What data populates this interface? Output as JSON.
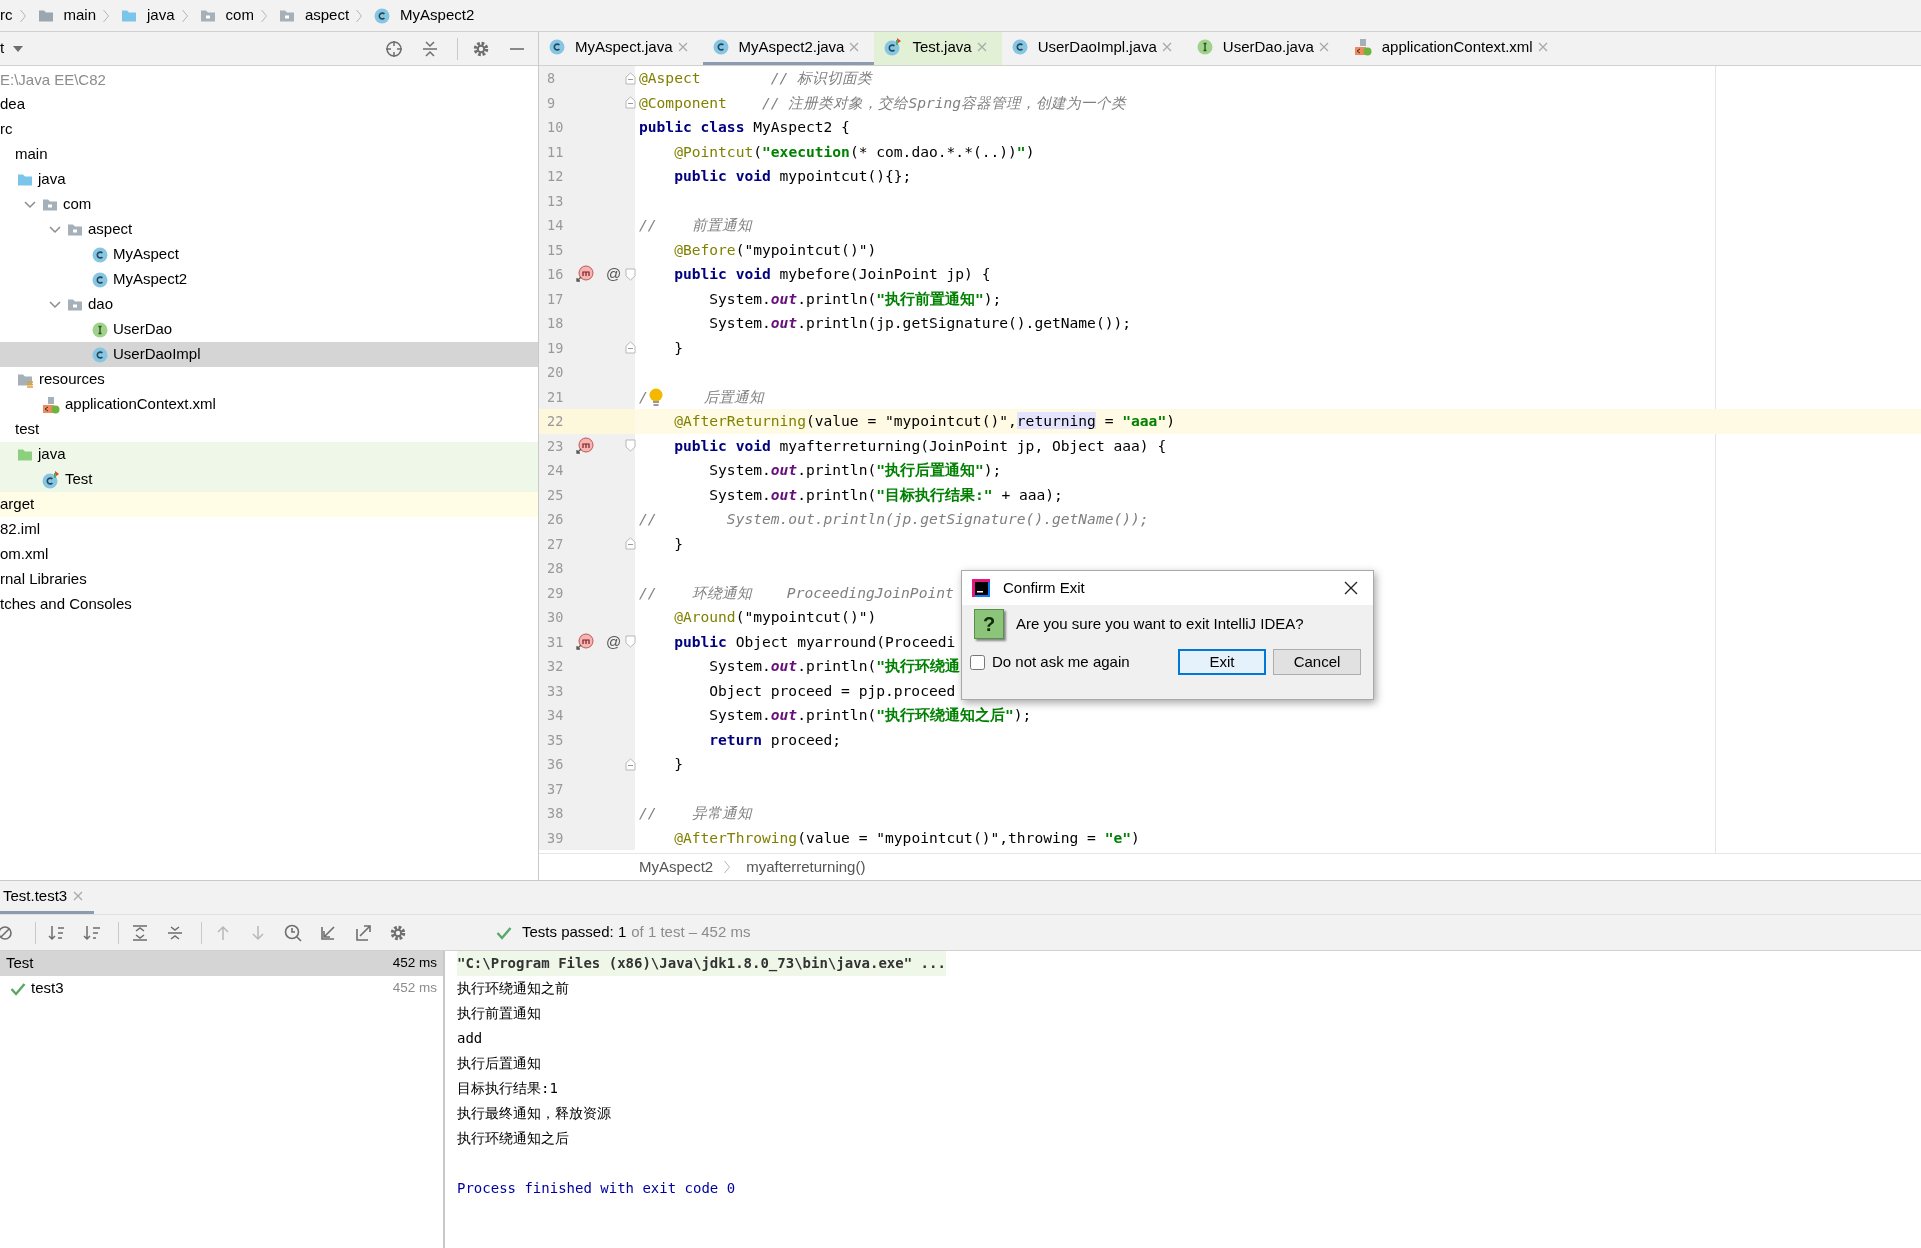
{
  "breadcrumb": [
    {
      "label": "rc"
    },
    {
      "label": "main",
      "kind": "folder"
    },
    {
      "label": "java",
      "kind": "source-folder"
    },
    {
      "label": "com",
      "kind": "package"
    },
    {
      "label": "aspect",
      "kind": "package"
    },
    {
      "label": "MyAspect2",
      "kind": "class"
    }
  ],
  "project": {
    "title": "t",
    "root_path": "E:\\Java EE\\C82",
    "items": [
      {
        "label": "dea",
        "selected": false
      },
      {
        "label": "rc",
        "selected": false,
        "children": [
          {
            "label": "main",
            "selected": false,
            "children": [
              {
                "label": "java",
                "kind": "source-folder",
                "selected": false,
                "children": [
                  {
                    "label": "com",
                    "kind": "package",
                    "selected": false,
                    "children": [
                      {
                        "label": "aspect",
                        "kind": "package",
                        "selected": false,
                        "children": [
                          {
                            "label": "MyAspect",
                            "kind": "class",
                            "selected": false
                          },
                          {
                            "label": "MyAspect2",
                            "kind": "class",
                            "selected": false
                          }
                        ]
                      },
                      {
                        "label": "dao",
                        "kind": "package",
                        "selected": false,
                        "children": [
                          {
                            "label": "UserDao",
                            "kind": "interface",
                            "selected": false
                          },
                          {
                            "label": "UserDaoImpl",
                            "kind": "class",
                            "selected": true
                          }
                        ]
                      }
                    ]
                  }
                ]
              },
              {
                "label": "resources",
                "kind": "resources",
                "selected": false,
                "children": [
                  {
                    "label": "applicationContext.xml",
                    "kind": "xml",
                    "selected": false
                  }
                ]
              }
            ]
          },
          {
            "label": "test",
            "selected": false,
            "children": [
              {
                "label": "java",
                "kind": "test-folder",
                "test_source": true,
                "selected": false,
                "children": [
                  {
                    "label": "Test",
                    "kind": "test-class",
                    "test_source": true,
                    "selected": false
                  }
                ]
              }
            ]
          }
        ]
      },
      {
        "label": "arget",
        "excluded": true,
        "selected": false
      },
      {
        "label": "82.iml",
        "selected": false
      },
      {
        "label": "om.xml",
        "selected": false
      },
      {
        "label": "rnal Libraries",
        "selected": false
      },
      {
        "label": "tches and Consoles",
        "selected": false
      }
    ]
  },
  "editor": {
    "tabs": [
      {
        "label": "MyAspect.java",
        "kind": "class",
        "selected": false
      },
      {
        "label": "MyAspect2.java",
        "kind": "class",
        "selected": true
      },
      {
        "label": "Test.java",
        "kind": "test-class",
        "test_source": true,
        "selected": false
      },
      {
        "label": "UserDaoImpl.java",
        "kind": "class",
        "selected": false
      },
      {
        "label": "UserDao.java",
        "kind": "interface",
        "selected": false
      },
      {
        "label": "applicationContext.xml",
        "kind": "xml",
        "selected": false
      }
    ],
    "lines": [
      {
        "number": "8",
        "current": false,
        "gutter": [
          {
            "kind": "fold-end"
          }
        ],
        "tokens": [
          {
            "kind": "annotation",
            "text": "@Aspect"
          },
          {
            "kind": "comment",
            "text": "        // 标识切面类"
          }
        ]
      },
      {
        "number": "9",
        "current": false,
        "gutter": [
          {
            "kind": "fold-end"
          }
        ],
        "tokens": [
          {
            "kind": "annotation",
            "text": "@Component"
          },
          {
            "kind": "comment",
            "text": "    // 注册类对象，交给Spring容器管理，创建为一个类"
          }
        ]
      },
      {
        "number": "10",
        "current": false,
        "tokens": [
          {
            "kind": "keyword",
            "text": "public class"
          },
          {
            "kind": "plain",
            "text": " MyAspect2 {"
          }
        ]
      },
      {
        "number": "11",
        "current": false,
        "tokens": [
          {
            "kind": "annotation",
            "text": "    @Pointcut"
          },
          {
            "kind": "plain",
            "text": "("
          },
          {
            "kind": "string",
            "text": "\"execution"
          },
          {
            "kind": "plain",
            "text": "(* com.dao.*.*(..))"
          },
          {
            "kind": "string",
            "text": "\""
          },
          {
            "kind": "plain",
            "text": ")"
          }
        ]
      },
      {
        "number": "12",
        "current": false,
        "tokens": [
          {
            "kind": "keyword",
            "text": "    public void"
          },
          {
            "kind": "plain",
            "text": " mypointcut(){};"
          }
        ]
      },
      {
        "number": "13",
        "current": false
      },
      {
        "number": "14",
        "current": false,
        "tokens": [
          {
            "kind": "comment",
            "text": "//    前置通知"
          }
        ]
      },
      {
        "number": "15",
        "current": false,
        "tokens": [
          {
            "kind": "annotation",
            "text": "    @Before"
          },
          {
            "kind": "plain",
            "text": "(\"mypointcut()\")"
          }
        ]
      },
      {
        "number": "16",
        "current": false,
        "gutter": [
          {
            "kind": "method"
          },
          {
            "kind": "annotation",
            "glyph": "@"
          },
          {
            "kind": "fold-start"
          }
        ],
        "tokens": [
          {
            "kind": "keyword",
            "text": "    public void"
          },
          {
            "kind": "plain",
            "text": " mybefore(JoinPoint jp) {"
          }
        ]
      },
      {
        "number": "17",
        "current": false,
        "tokens": [
          {
            "kind": "plain",
            "text": "        System."
          },
          {
            "kind": "field",
            "text": "out"
          },
          {
            "kind": "plain",
            "text": ".println("
          },
          {
            "kind": "string",
            "text": "\"执行前置通知\""
          },
          {
            "kind": "plain",
            "text": ");"
          }
        ]
      },
      {
        "number": "18",
        "current": false,
        "tokens": [
          {
            "kind": "plain",
            "text": "        System."
          },
          {
            "kind": "field",
            "text": "out"
          },
          {
            "kind": "plain",
            "text": ".println(jp.getSignature().getName());"
          }
        ]
      },
      {
        "number": "19",
        "current": false,
        "gutter": [
          {
            "kind": "fold-end"
          }
        ],
        "tokens": [
          {
            "kind": "plain",
            "text": "    }"
          }
        ]
      },
      {
        "number": "20",
        "current": false
      },
      {
        "number": "21",
        "current": false,
        "tokens": [
          {
            "kind": "comment",
            "text": "/"
          },
          {
            "kind": "bulb"
          },
          {
            "kind": "comment",
            "text": "    后置通知"
          }
        ]
      },
      {
        "number": "22",
        "current": true,
        "tokens": [
          {
            "kind": "annotation",
            "text": "    @AfterReturning"
          },
          {
            "kind": "plain",
            "text": "(value = \"mypointcut()\","
          },
          {
            "kind": "highlight",
            "text": "returning"
          },
          {
            "kind": "plain",
            "text": " = "
          },
          {
            "kind": "string",
            "text": "\"aaa\""
          },
          {
            "kind": "plain",
            "text": ")"
          }
        ]
      },
      {
        "number": "23",
        "current": false,
        "gutter": [
          {
            "kind": "method"
          },
          {
            "kind": "fold-start"
          }
        ],
        "tokens": [
          {
            "kind": "keyword",
            "text": "    public void"
          },
          {
            "kind": "plain",
            "text": " myafterreturning(JoinPoint jp, Object aaa) {"
          }
        ]
      },
      {
        "number": "24",
        "current": false,
        "tokens": [
          {
            "kind": "plain",
            "text": "        System."
          },
          {
            "kind": "field",
            "text": "out"
          },
          {
            "kind": "plain",
            "text": ".println("
          },
          {
            "kind": "string",
            "text": "\"执行后置通知\""
          },
          {
            "kind": "plain",
            "text": ");"
          }
        ]
      },
      {
        "number": "25",
        "current": false,
        "tokens": [
          {
            "kind": "plain",
            "text": "        System."
          },
          {
            "kind": "field",
            "text": "out"
          },
          {
            "kind": "plain",
            "text": ".println("
          },
          {
            "kind": "string",
            "text": "\"目标执行结果:\""
          },
          {
            "kind": "plain",
            "text": " + aaa);"
          }
        ]
      },
      {
        "number": "26",
        "current": false,
        "tokens": [
          {
            "kind": "comment",
            "text": "//        System.out.println(jp.getSignature().getName());"
          }
        ]
      },
      {
        "number": "27",
        "current": false,
        "gutter": [
          {
            "kind": "fold-end"
          }
        ],
        "tokens": [
          {
            "kind": "plain",
            "text": "    }"
          }
        ]
      },
      {
        "number": "28",
        "current": false
      },
      {
        "number": "29",
        "current": false,
        "tokens": [
          {
            "kind": "comment",
            "text": "//    环绕通知    ProceedingJoinPoint"
          }
        ]
      },
      {
        "number": "30",
        "current": false,
        "tokens": [
          {
            "kind": "annotation",
            "text": "    @Around"
          },
          {
            "kind": "plain",
            "text": "(\"mypointcut()\")"
          }
        ]
      },
      {
        "number": "31",
        "current": false,
        "gutter": [
          {
            "kind": "method"
          },
          {
            "kind": "annotation",
            "glyph": "@"
          },
          {
            "kind": "fold-start"
          }
        ],
        "tokens": [
          {
            "kind": "keyword",
            "text": "    public"
          },
          {
            "kind": "plain",
            "text": " Object myarround(Proceedi"
          }
        ]
      },
      {
        "number": "32",
        "current": false,
        "tokens": [
          {
            "kind": "plain",
            "text": "        System."
          },
          {
            "kind": "field",
            "text": "out"
          },
          {
            "kind": "plain",
            "text": ".println("
          },
          {
            "kind": "string",
            "text": "\"执行环绕通"
          }
        ]
      },
      {
        "number": "33",
        "current": false,
        "tokens": [
          {
            "kind": "plain",
            "text": "        Object proceed = pjp.proceed"
          }
        ]
      },
      {
        "number": "34",
        "current": false,
        "tokens": [
          {
            "kind": "plain",
            "text": "        System."
          },
          {
            "kind": "field",
            "text": "out"
          },
          {
            "kind": "plain",
            "text": ".println("
          },
          {
            "kind": "string",
            "text": "\"执行环绕通知之后\""
          },
          {
            "kind": "plain",
            "text": ");"
          }
        ]
      },
      {
        "number": "35",
        "current": false,
        "tokens": [
          {
            "kind": "keyword",
            "text": "        return"
          },
          {
            "kind": "plain",
            "text": " proceed;"
          }
        ]
      },
      {
        "number": "36",
        "current": false,
        "gutter": [
          {
            "kind": "fold-end"
          }
        ],
        "tokens": [
          {
            "kind": "plain",
            "text": "    }"
          }
        ]
      },
      {
        "number": "37",
        "current": false
      },
      {
        "number": "38",
        "current": false,
        "tokens": [
          {
            "kind": "comment",
            "text": "//    异常通知"
          }
        ]
      },
      {
        "number": "39",
        "current": false,
        "tokens": [
          {
            "kind": "annotation",
            "text": "    @AfterThrowing"
          },
          {
            "kind": "plain",
            "text": "(value = \"mypointcut()\",throwing = "
          },
          {
            "kind": "string",
            "text": "\"e\""
          },
          {
            "kind": "plain",
            "text": ")"
          }
        ]
      }
    ],
    "path": [
      "MyAspect2",
      "myafterreturning()"
    ]
  },
  "dialog": {
    "title": "Confirm Exit",
    "glyph": "?",
    "message": "Are you sure you want to exit IntelliJ IDEA?",
    "dont_ask": {
      "label": "Do not ask me again",
      "checked": false
    },
    "buttons": [
      {
        "label": "Exit",
        "default": true
      },
      {
        "label": "Cancel",
        "default": false
      }
    ]
  },
  "run": {
    "tab": {
      "label": "Test.test3",
      "selected": true
    },
    "status": {
      "passed": "Tests passed: 1",
      "detail": "of 1 test – 452 ms"
    },
    "tests": [
      {
        "label": "Test",
        "time": "452 ms",
        "selected": true
      },
      {
        "label": "test3",
        "time": "452 ms",
        "selected": false,
        "passed": true
      }
    ],
    "console": [
      {
        "kind": "command",
        "text": "\"C:\\Program Files (x86)\\Java\\jdk1.8.0_73\\bin\\java.exe\" ..."
      },
      {
        "kind": "output",
        "text": "执行环绕通知之前"
      },
      {
        "kind": "output",
        "text": "执行前置通知"
      },
      {
        "kind": "output",
        "text": "add"
      },
      {
        "kind": "output",
        "text": "执行后置通知"
      },
      {
        "kind": "output",
        "text": "目标执行结果:1"
      },
      {
        "kind": "output",
        "text": "执行最终通知，释放资源"
      },
      {
        "kind": "output",
        "text": "执行环绕通知之后"
      },
      {
        "kind": "exit",
        "text": "Process finished with exit code 0"
      }
    ]
  }
}
